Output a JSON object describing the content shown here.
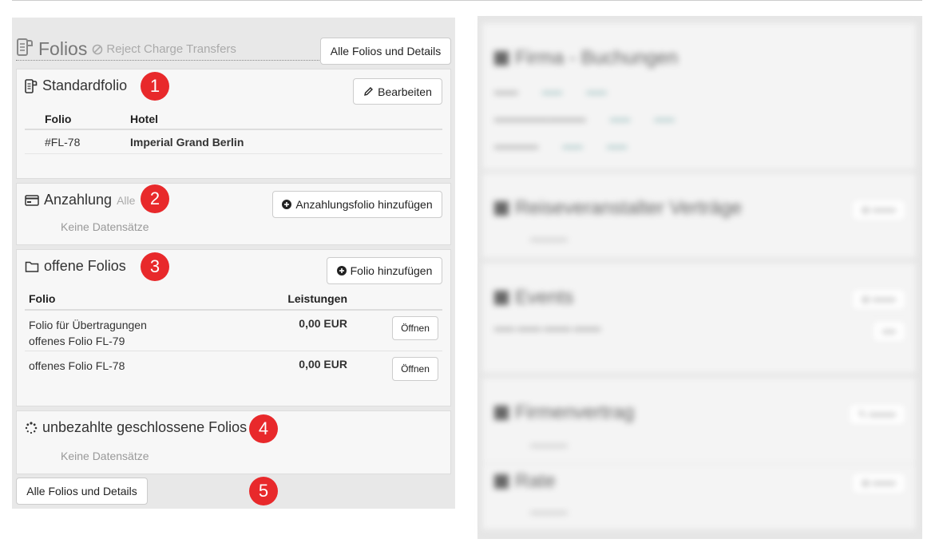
{
  "folios_panel": {
    "title": "Folios",
    "subtitle": "Reject Charge Transfers",
    "all_details_label": "Alle Folios und Details",
    "footer_all_details_label": "Alle Folios und Details"
  },
  "standard_folio": {
    "title": "Standardfolio",
    "edit_label": "Bearbeiten",
    "columns": [
      "Folio",
      "Hotel"
    ],
    "rows": [
      {
        "folio": "#FL-78",
        "hotel": "Imperial Grand Berlin"
      }
    ]
  },
  "deposit": {
    "title": "Anzahlung",
    "hint": "Alle",
    "add_label": "Anzahlungsfolio hinzufügen",
    "empty": "Keine Datensätze"
  },
  "open_folios": {
    "title": "offene Folios",
    "add_label": "Folio hinzufügen",
    "columns": [
      "Folio",
      "Leistungen"
    ],
    "rows": [
      {
        "line1": "Folio für Übertragungen",
        "line2": "offenes Folio FL-79",
        "amount": "0,00 EUR",
        "action": "Öffnen"
      },
      {
        "line1": "offenes Folio FL-78",
        "line2": "",
        "amount": "0,00 EUR",
        "action": "Öffnen"
      }
    ]
  },
  "unpaid_closed": {
    "title": "unbezahlte geschlossene Folios",
    "empty": "Keine Datensätze"
  },
  "markers": [
    "1",
    "2",
    "3",
    "4",
    "5"
  ],
  "colors": {
    "marker": "#e8292b",
    "panel_bg": "#e8e8e8",
    "section_bg": "#f7f7f7"
  },
  "blurred_panel": {
    "company_bookings_title": "Firma - Buchungen",
    "tour_contracts_title": "Reiseveranstalter Verträge",
    "events_title": "Events",
    "company_contract_title": "Firmenvertrag",
    "rate_title": "Rate"
  }
}
